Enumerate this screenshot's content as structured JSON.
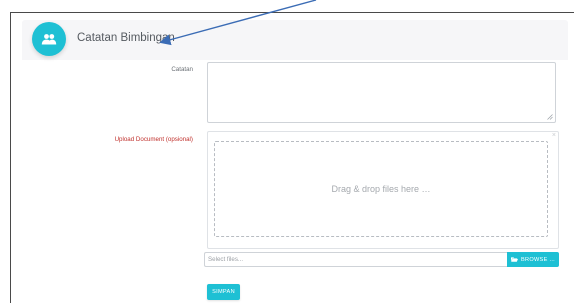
{
  "header": {
    "title": "Catatan Bimbingan",
    "icon": "users-icon"
  },
  "form": {
    "catatan_label": "Catatan",
    "catatan_value": "",
    "upload_label": "Upload Document (opsional)",
    "drop_text": "Drag & drop files here …",
    "file_placeholder": "Select files...",
    "browse_label": "BROWSE ...",
    "save_label": "SIMPAN"
  },
  "colors": {
    "accent": "#1ec0d4",
    "required_label": "#c0312d",
    "annotation_arrow": "#3b6cb5"
  }
}
